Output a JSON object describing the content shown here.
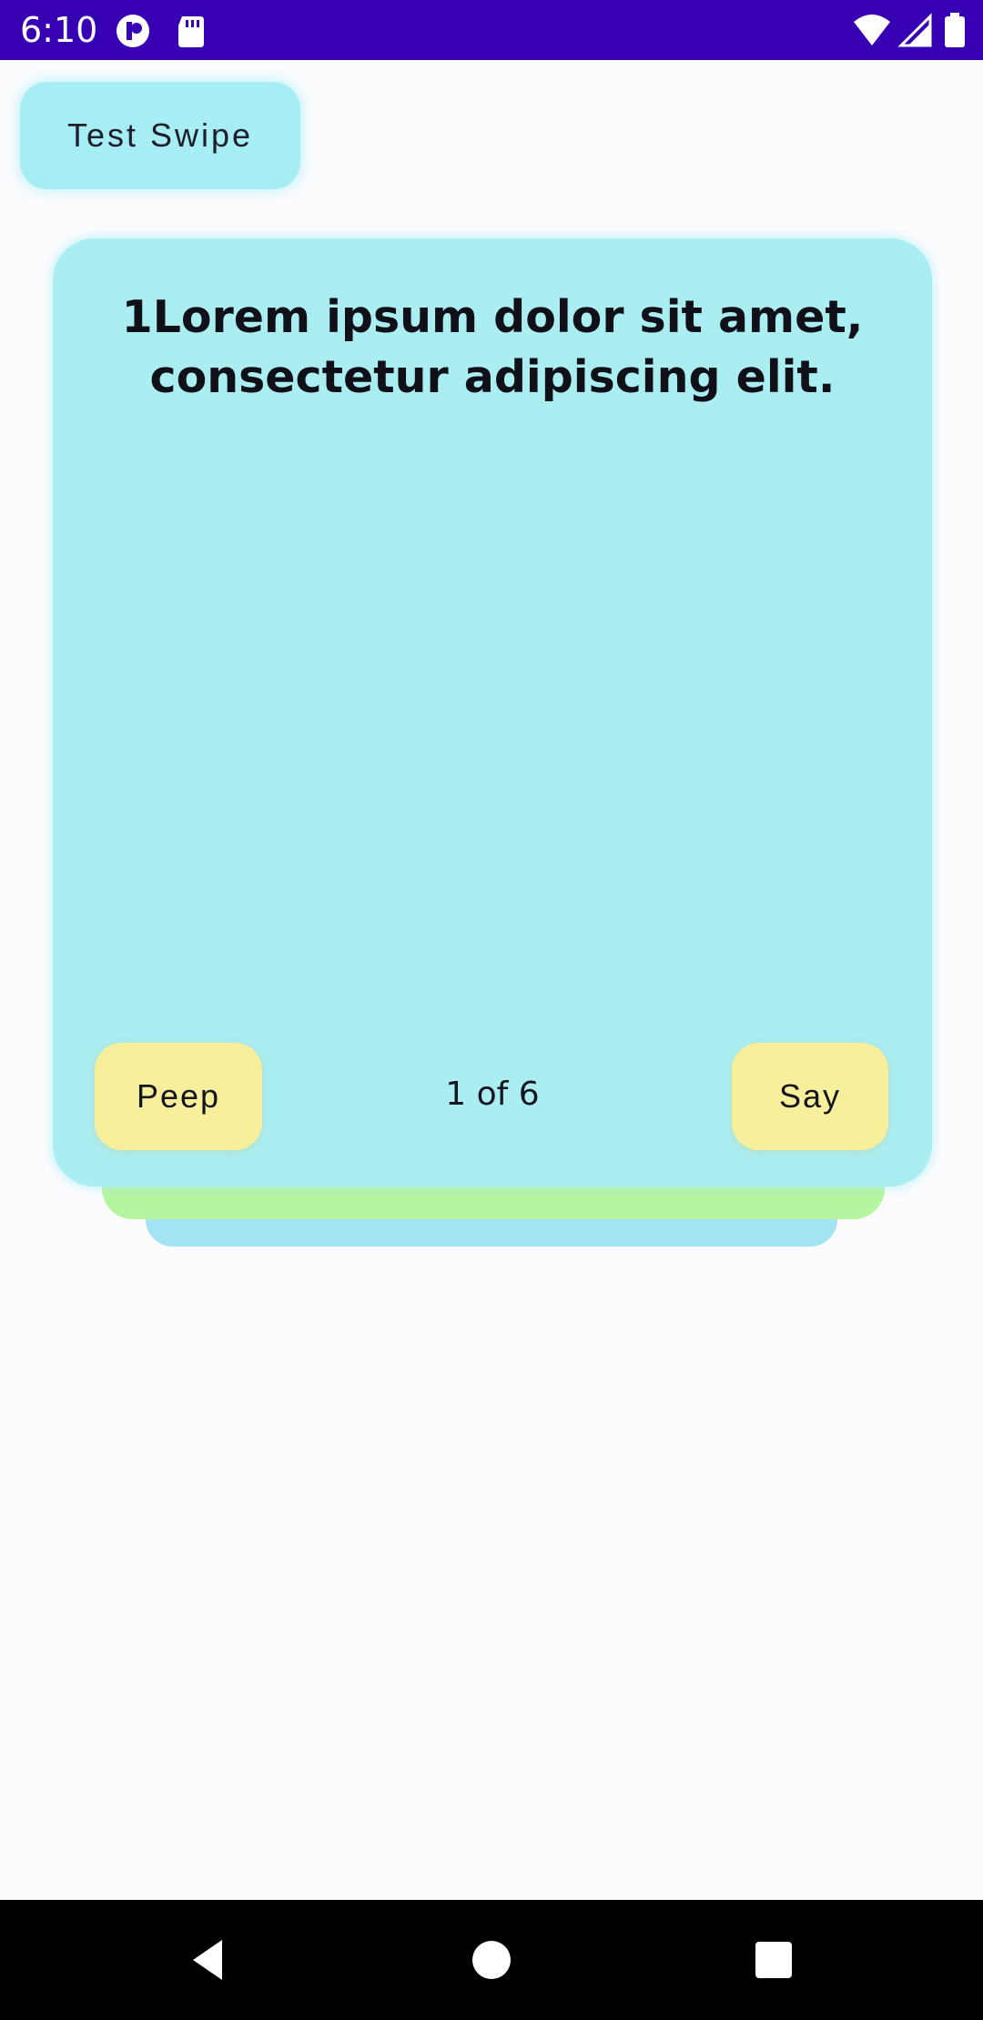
{
  "status_bar": {
    "time": "6:10",
    "icons": [
      "notification-app-icon",
      "sd-card-icon",
      "wifi-icon",
      "signal-icon",
      "battery-icon"
    ],
    "background": "#3700b3"
  },
  "toolbar": {
    "test_swipe_label": "Test Swipe"
  },
  "card": {
    "text": "1Lorem ipsum dolor sit amet, consectetur adipiscing elit.",
    "peep_label": "Peep",
    "say_label": "Say",
    "counter": "1 of 6",
    "colors": {
      "card": "#abeef2",
      "button": "#f7ef9c",
      "back_card_1": "#b6f4a0",
      "back_card_2": "#a2e3f4"
    }
  },
  "nav_bar": {
    "icons": [
      "back-icon",
      "home-icon",
      "recents-icon"
    ]
  }
}
